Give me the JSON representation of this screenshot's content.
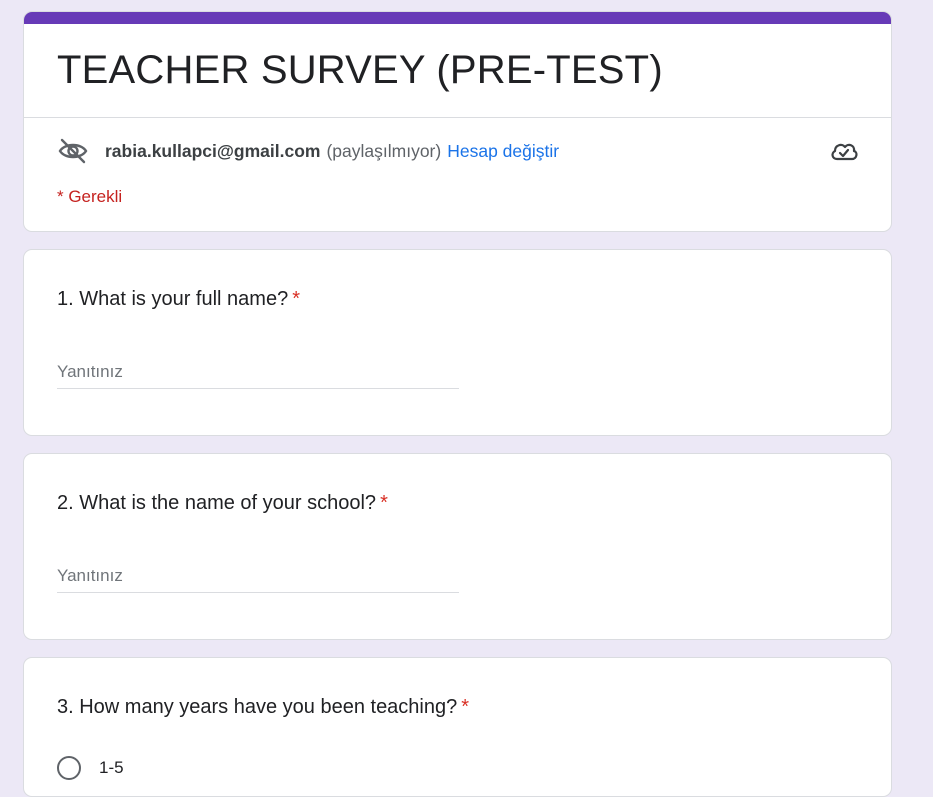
{
  "form": {
    "title": "TEACHER SURVEY (PRE-TEST)",
    "account_email": "rabia.kullapci@gmail.com",
    "not_shared": "(paylaşılmıyor)",
    "switch_account": "Hesap değiştir",
    "required_note": "* Gerekli",
    "accent_color": "#673ab7",
    "background_color": "#ece8f6"
  },
  "questions": [
    {
      "label": "1. What is your full name?",
      "required_mark": "*",
      "placeholder": "Yanıtınız",
      "value": ""
    },
    {
      "label": "2. What is the name of your school?",
      "required_mark": "*",
      "placeholder": "Yanıtınız",
      "value": ""
    },
    {
      "label": "3. How many years have you been teaching?",
      "required_mark": "*",
      "options": [
        "1-5"
      ]
    }
  ],
  "icons": {
    "visibility": "eye-off-icon",
    "save_status": "cloud-check-icon",
    "radio": "radio-unselected-icon"
  }
}
